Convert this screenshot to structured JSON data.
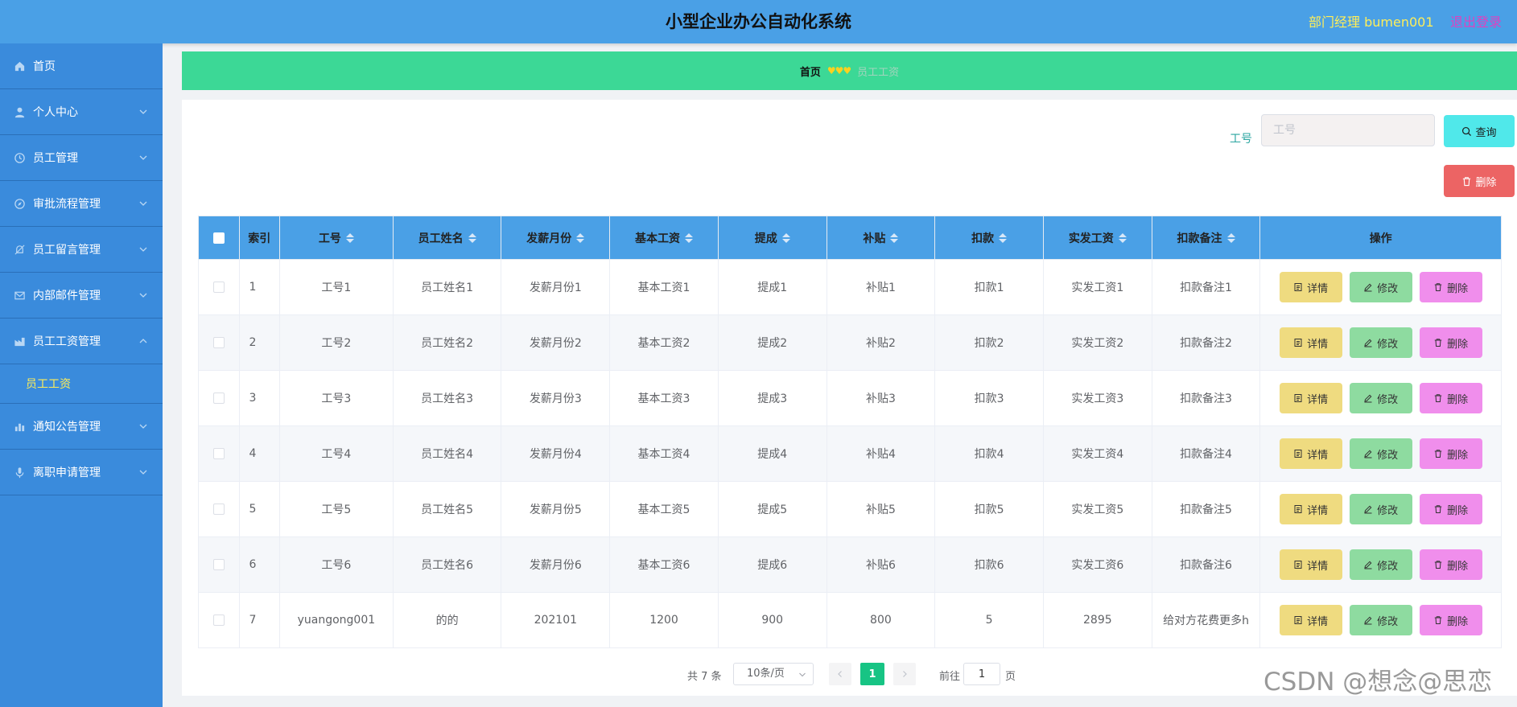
{
  "header": {
    "title": "小型企业办公自动化系统",
    "user_label": "部门经理 bumen001",
    "logout_label": "退出登录"
  },
  "sidebar": {
    "items": [
      {
        "label": "首页",
        "icon": "home-icon"
      },
      {
        "label": "个人中心",
        "icon": "user-icon"
      },
      {
        "label": "员工管理",
        "icon": "clock-icon"
      },
      {
        "label": "审批流程管理",
        "icon": "compass-icon"
      },
      {
        "label": "员工留言管理",
        "icon": "mute-icon"
      },
      {
        "label": "内部邮件管理",
        "icon": "mail-icon"
      },
      {
        "label": "员工工资管理",
        "icon": "factory-icon"
      },
      {
        "label": "通知公告管理",
        "icon": "bar-chart-icon"
      },
      {
        "label": "离职申请管理",
        "icon": "microphone-icon"
      }
    ],
    "active_sub": "员工工资"
  },
  "breadcrumb": {
    "home": "首页",
    "separator": "♥♥♥",
    "current": "员工工资"
  },
  "search": {
    "label": "工号",
    "placeholder": "工号",
    "value": "",
    "query_label": "查询",
    "delete_label": "删除"
  },
  "table": {
    "headers": {
      "index": "索引",
      "gonghao": "工号",
      "name": "员工姓名",
      "month": "发薪月份",
      "base": "基本工资",
      "commission": "提成",
      "subsidy": "补贴",
      "deduction": "扣款",
      "actual": "实发工资",
      "remark": "扣款备注",
      "ops": "操作"
    },
    "rows": [
      {
        "index": "1",
        "gonghao": "工号1",
        "name": "员工姓名1",
        "month": "发薪月份1",
        "base": "基本工资1",
        "commission": "提成1",
        "subsidy": "补贴1",
        "deduction": "扣款1",
        "actual": "实发工资1",
        "remark": "扣款备注1"
      },
      {
        "index": "2",
        "gonghao": "工号2",
        "name": "员工姓名2",
        "month": "发薪月份2",
        "base": "基本工资2",
        "commission": "提成2",
        "subsidy": "补贴2",
        "deduction": "扣款2",
        "actual": "实发工资2",
        "remark": "扣款备注2"
      },
      {
        "index": "3",
        "gonghao": "工号3",
        "name": "员工姓名3",
        "month": "发薪月份3",
        "base": "基本工资3",
        "commission": "提成3",
        "subsidy": "补贴3",
        "deduction": "扣款3",
        "actual": "实发工资3",
        "remark": "扣款备注3"
      },
      {
        "index": "4",
        "gonghao": "工号4",
        "name": "员工姓名4",
        "month": "发薪月份4",
        "base": "基本工资4",
        "commission": "提成4",
        "subsidy": "补贴4",
        "deduction": "扣款4",
        "actual": "实发工资4",
        "remark": "扣款备注4"
      },
      {
        "index": "5",
        "gonghao": "工号5",
        "name": "员工姓名5",
        "month": "发薪月份5",
        "base": "基本工资5",
        "commission": "提成5",
        "subsidy": "补贴5",
        "deduction": "扣款5",
        "actual": "实发工资5",
        "remark": "扣款备注5"
      },
      {
        "index": "6",
        "gonghao": "工号6",
        "name": "员工姓名6",
        "month": "发薪月份6",
        "base": "基本工资6",
        "commission": "提成6",
        "subsidy": "补贴6",
        "deduction": "扣款6",
        "actual": "实发工资6",
        "remark": "扣款备注6"
      },
      {
        "index": "7",
        "gonghao": "yuangong001",
        "name": "的的",
        "month": "202101",
        "base": "1200",
        "commission": "900",
        "subsidy": "800",
        "deduction": "5",
        "actual": "2895",
        "remark": "给对方花费更多h"
      }
    ],
    "actions": {
      "detail": "详情",
      "edit": "修改",
      "delete": "删除"
    }
  },
  "pagination": {
    "total_text": "共 7 条",
    "page_size": "10条/页",
    "current_page": "1",
    "goto_label": "前往",
    "goto_value": "1",
    "page_suffix": "页"
  },
  "watermark": "CSDN @想念@思恋",
  "colors": {
    "header_bg": "#4aa0e6",
    "sidebar_bg": "#3a8bdc",
    "breadcrumb_bg": "#3cd896",
    "query_button": "#50e8ea",
    "delete_button": "#ec6464",
    "detail_button": "#efdb80",
    "edit_button": "#8edba0",
    "row_delete_button": "#f08eec",
    "active_page": "#17c484"
  }
}
